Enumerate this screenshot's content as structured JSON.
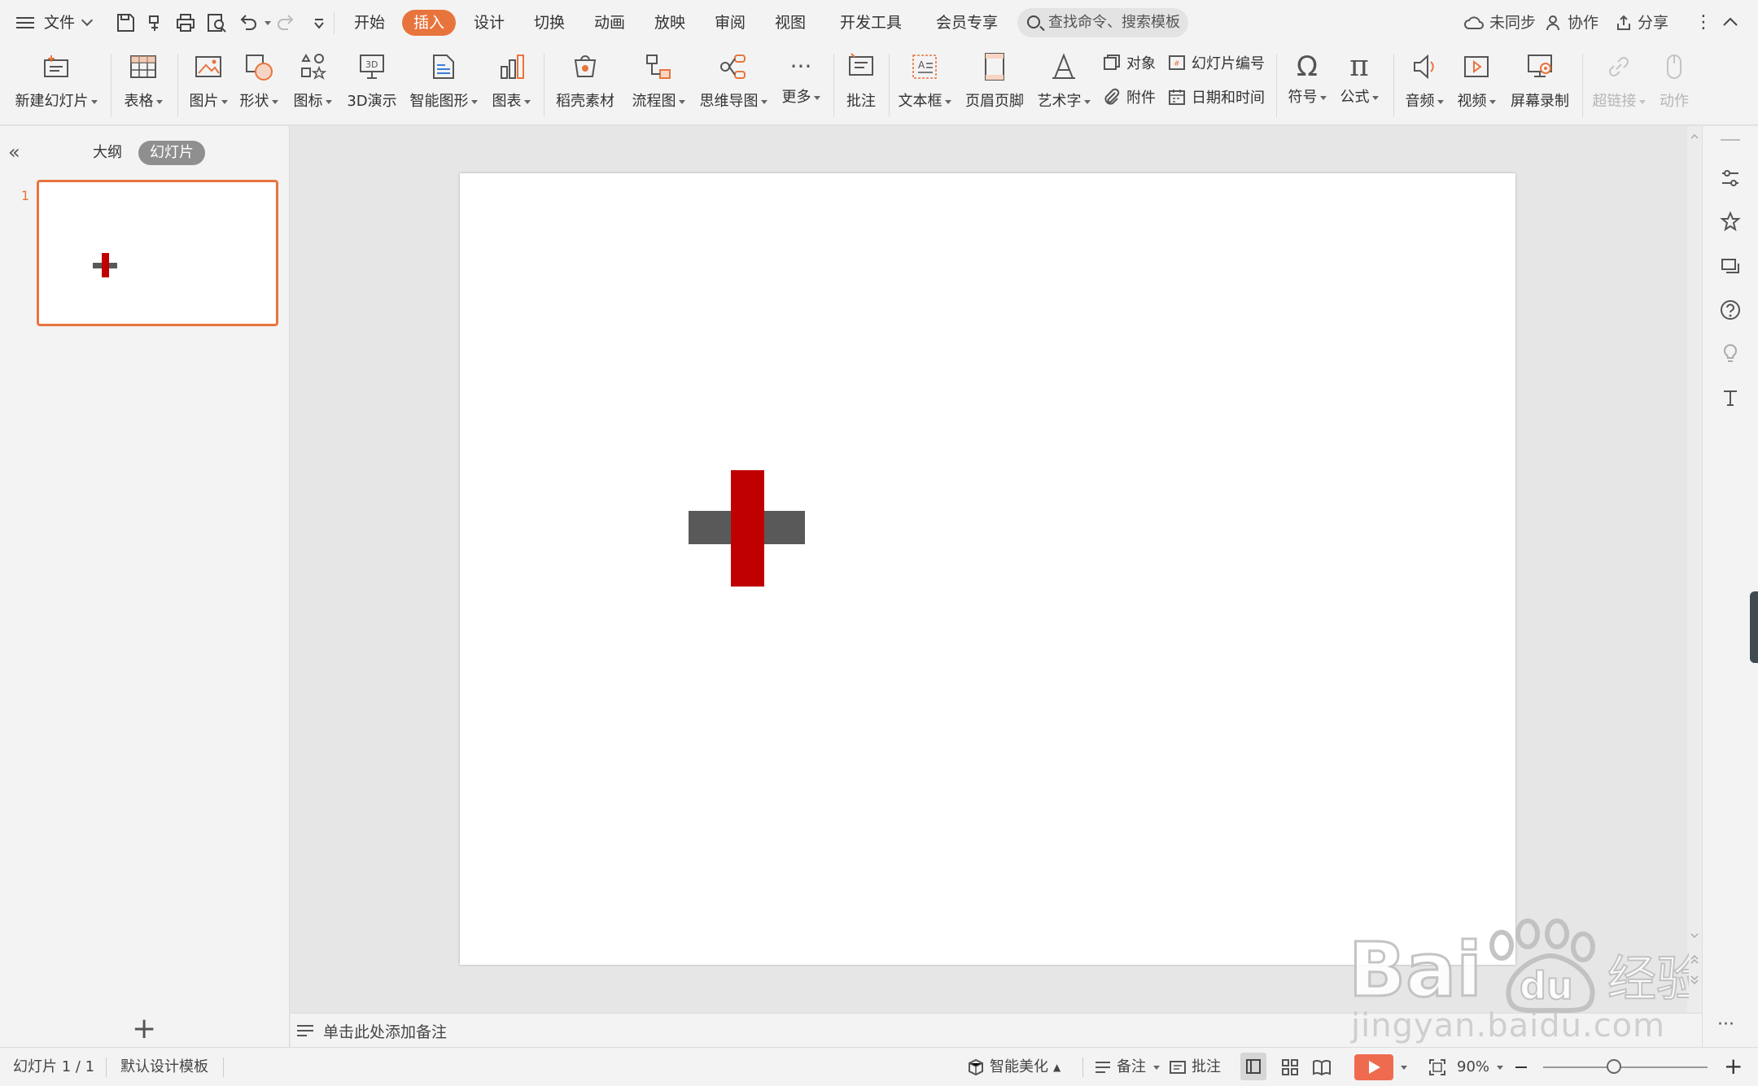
{
  "menubar": {
    "file_label": "文件",
    "tabs": [
      {
        "label": "开始",
        "active": false
      },
      {
        "label": "插入",
        "active": true
      },
      {
        "label": "设计",
        "active": false
      },
      {
        "label": "切换",
        "active": false
      },
      {
        "label": "动画",
        "active": false
      },
      {
        "label": "放映",
        "active": false
      },
      {
        "label": "审阅",
        "active": false
      },
      {
        "label": "视图",
        "active": false
      },
      {
        "label": "开发工具",
        "active": false
      },
      {
        "label": "会员专享",
        "active": false
      }
    ],
    "search_placeholder": "查找命令、搜索模板",
    "sync_label": "未同步",
    "collab_label": "协作",
    "share_label": "分享"
  },
  "ribbon": {
    "new_slide": "新建幻灯片",
    "table": "表格",
    "picture": "图片",
    "shape": "形状",
    "icon": "图标",
    "threed": "3D演示",
    "smart_art": "智能图形",
    "chart": "图表",
    "docer": "稻壳素材",
    "flowchart": "流程图",
    "mindmap": "思维导图",
    "more": "更多",
    "comment": "批注",
    "textbox": "文本框",
    "header_footer": "页眉页脚",
    "wordart": "艺术字",
    "object": "对象",
    "slide_number": "幻灯片编号",
    "attachment": "附件",
    "datetime": "日期和时间",
    "symbol": "符号",
    "formula": "公式",
    "audio": "音频",
    "video": "视频",
    "screen_record": "屏幕录制",
    "hyperlink": "超链接",
    "action": "动作"
  },
  "left_panel": {
    "outline_tab": "大纲",
    "slides_tab": "幻灯片",
    "slide_number": "1"
  },
  "notes": {
    "placeholder": "单击此处添加备注"
  },
  "status": {
    "slide_info": "幻灯片 1 / 1",
    "template": "默认设计模板",
    "beautify": "智能美化",
    "notes": "备注",
    "comments": "批注",
    "zoom": "90%"
  },
  "slide_content": {
    "cross_bar_color": "#595959",
    "cross_vertical_color": "#c00000"
  },
  "watermark": {
    "url_text": "jingyan.baidu.com"
  }
}
